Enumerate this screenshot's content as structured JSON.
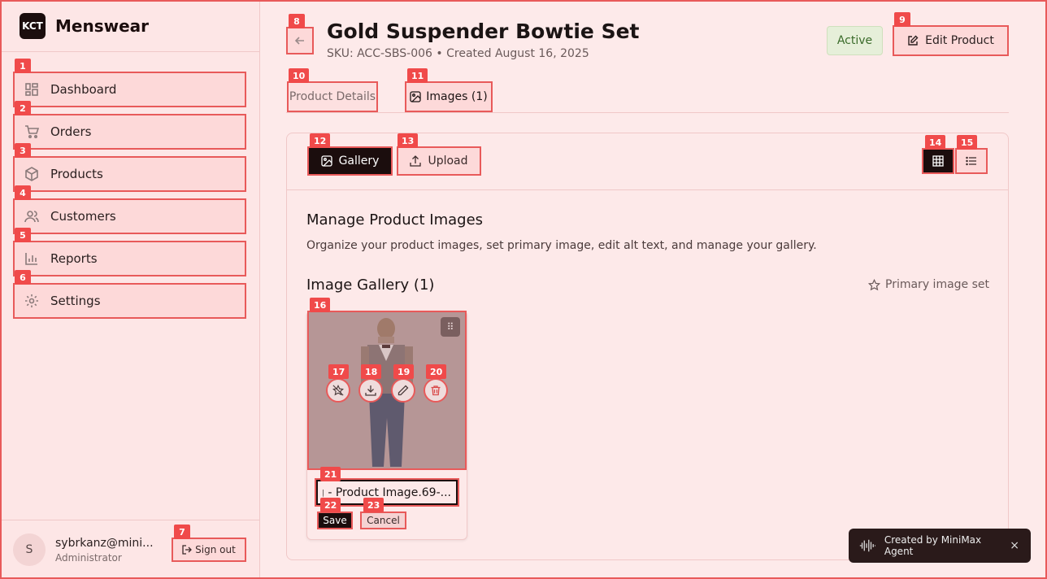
{
  "brand": {
    "logo_text": "KCT",
    "name": "Menswear"
  },
  "sidebar": {
    "items": [
      {
        "label": "Dashboard",
        "icon": "dashboard-icon",
        "badge": "1"
      },
      {
        "label": "Orders",
        "icon": "cart-icon",
        "badge": "2"
      },
      {
        "label": "Products",
        "icon": "box-icon",
        "badge": "3"
      },
      {
        "label": "Customers",
        "icon": "users-icon",
        "badge": "4"
      },
      {
        "label": "Reports",
        "icon": "bar-chart-icon",
        "badge": "5"
      },
      {
        "label": "Settings",
        "icon": "gear-icon",
        "badge": "6"
      }
    ],
    "user": {
      "initial": "S",
      "email": "sybrkanz@mini...",
      "role": "Administrator"
    },
    "signout_label": "Sign out",
    "signout_badge": "7"
  },
  "header": {
    "back_badge": "8",
    "title": "Gold Suspender Bowtie Set",
    "subtitle": "SKU: ACC-SBS-006 • Created August 16, 2025",
    "status": "Active",
    "edit_label": "Edit Product",
    "edit_badge": "9"
  },
  "tabs": [
    {
      "label": "Product Details",
      "badge": "10"
    },
    {
      "label": "Images (1)",
      "badge": "11"
    }
  ],
  "toolbar": {
    "gallery_label": "Gallery",
    "gallery_badge": "12",
    "upload_label": "Upload",
    "upload_badge": "13",
    "grid_badge": "14",
    "list_badge": "15"
  },
  "content": {
    "section_title": "Manage Product Images",
    "section_desc": "Organize your product images, set primary image, edit alt text, and manage your gallery.",
    "gallery_title": "Image Gallery (1)",
    "primary_note": "Primary image set"
  },
  "image_card": {
    "image_badge": "16",
    "actions": [
      {
        "icon": "star-off-icon",
        "badge": "17"
      },
      {
        "icon": "download-icon",
        "badge": "18"
      },
      {
        "icon": "pencil-icon",
        "badge": "19"
      },
      {
        "icon": "trash-icon",
        "badge": "20"
      }
    ],
    "alt_value": "...-69.jpg - Product Image",
    "alt_badge": "21",
    "save_label": "Save",
    "save_badge": "22",
    "cancel_label": "Cancel",
    "cancel_badge": "23"
  },
  "toast": {
    "text": "Created by MiniMax Agent",
    "close": "×"
  },
  "colors": {
    "accent": "#1b0d0d",
    "highlight": "#e85a5a",
    "background": "#fdeaea",
    "active_status": "#3a6b2a"
  }
}
